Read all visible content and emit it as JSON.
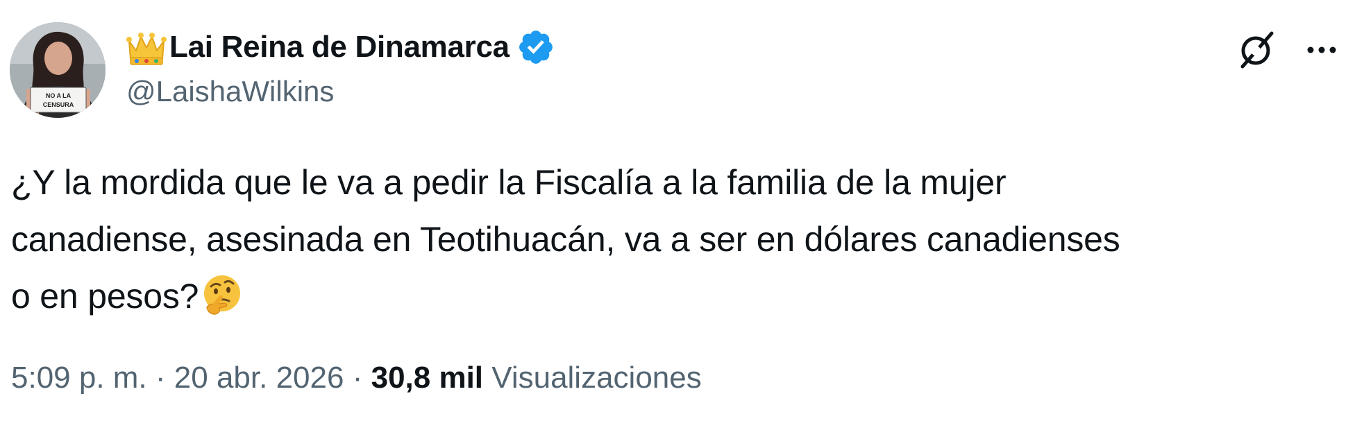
{
  "author": {
    "display_name": "Lai Reina de Dinamarca",
    "handle": "@LaishaWilkins",
    "verified": true,
    "badge_color": "#1d9bf0",
    "name_prefix_emoji": "crown",
    "avatar_sign_text": "NO A LA CENSURA"
  },
  "tweet": {
    "lines": [
      "¿Y la mordida que le va a pedir la Fiscalía a la familia de la mujer",
      "canadiense, asesinada en Teotihuacán, va a ser en dólares canadienses",
      "o en pesos?"
    ],
    "trailing_emoji": "thinking-face"
  },
  "meta": {
    "time": "5:09 p. m.",
    "separator": "·",
    "date": "20 abr. 2026",
    "views_count": "30,8 mil",
    "views_label": "Visualizaciones"
  },
  "actions": {
    "grok_icon": "grok-icon",
    "more_icon": "more-icon"
  },
  "colors": {
    "text_primary": "#0f1419",
    "text_secondary": "#536471",
    "background": "#ffffff"
  }
}
